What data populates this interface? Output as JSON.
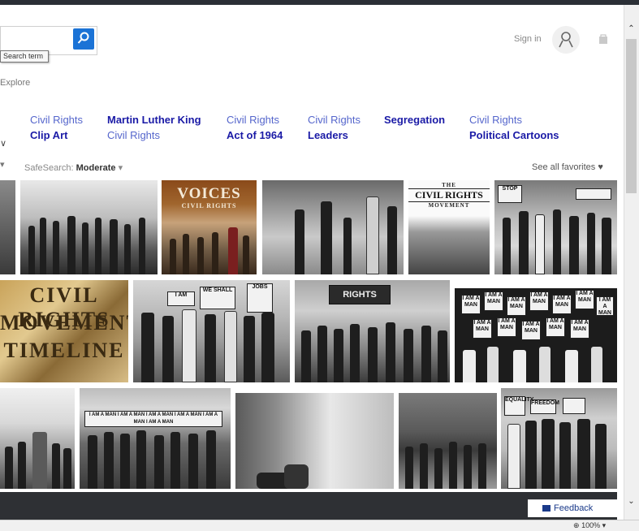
{
  "search": {
    "tooltip": "Search term",
    "explore": "Explore"
  },
  "header": {
    "signin": "Sign in"
  },
  "related": [
    {
      "line1": "Civil Rights",
      "line2": "Clip Art"
    },
    {
      "line1": "Martin Luther King",
      "line2": "Civil Rights"
    },
    {
      "line1": "Civil Rights",
      "line2": "Act of 1964"
    },
    {
      "line1": "Civil Rights",
      "line2": "Leaders"
    },
    {
      "line1": "Segregation",
      "line2": ""
    },
    {
      "line1": "Civil Rights",
      "line2": "Political Cartoons"
    }
  ],
  "filters": {
    "safesearch_label": "SafeSearch:",
    "safesearch_value": "Moderate",
    "favorites": "See all favorites"
  },
  "images": {
    "voices_title": "VOICES",
    "voices_sub": "CIVIL RIGHTS",
    "movement_title": "CIVIL RIGHTS",
    "movement_the": "THE",
    "movement_sub": "MOVEMENT",
    "iam_sign": "I AM A MAN",
    "rights_banner": "RIGHTS"
  },
  "footer": {
    "feedback": "Feedback",
    "zoom": "100%"
  },
  "colors": {
    "link_light": "#5566cc",
    "link_bold": "#1a1aa6",
    "search_button": "#1b73d6",
    "bottom_bar": "#2e3034"
  }
}
